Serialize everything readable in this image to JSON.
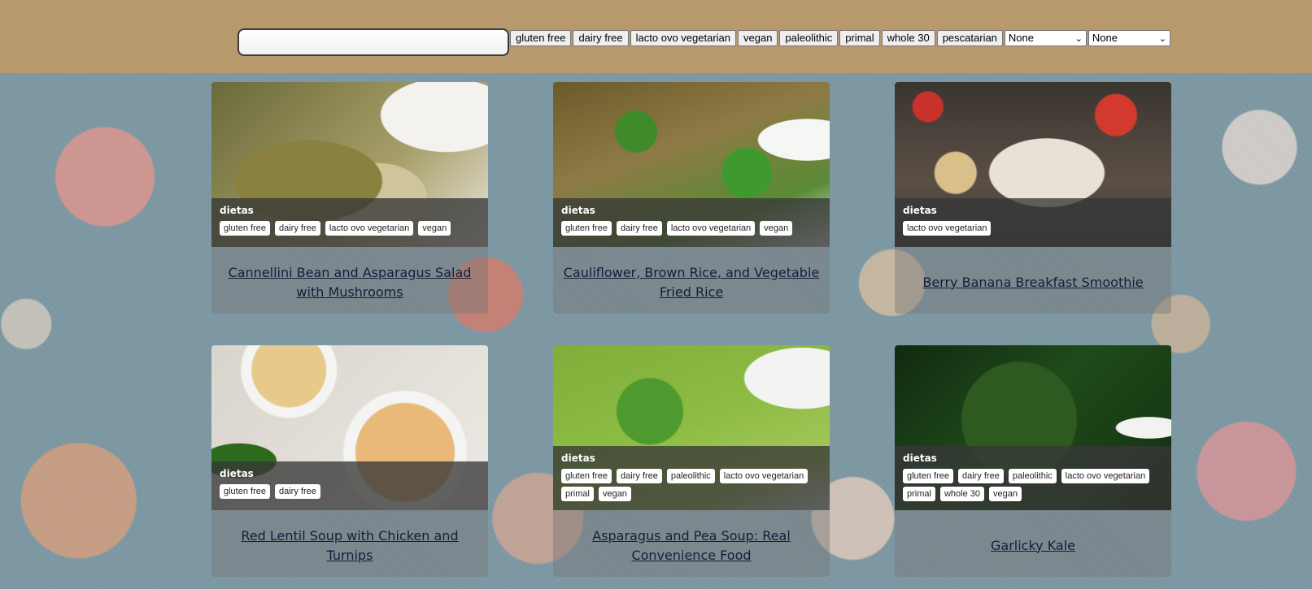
{
  "search": {
    "value": "",
    "placeholder": ""
  },
  "filters": [
    "gluten free",
    "dairy free",
    "lacto ovo vegetarian",
    "vegan",
    "paleolithic",
    "primal",
    "whole 30",
    "pescatarian"
  ],
  "selects": [
    {
      "value": "None"
    },
    {
      "value": "None"
    }
  ],
  "cards": [
    {
      "diet_label": "dietas",
      "tags": [
        "gluten free",
        "dairy free",
        "lacto ovo vegetarian",
        "vegan"
      ],
      "title": "Cannellini Bean and Asparagus Salad with Mushrooms"
    },
    {
      "diet_label": "dietas",
      "tags": [
        "gluten free",
        "dairy free",
        "lacto ovo vegetarian",
        "vegan"
      ],
      "title": "Cauliflower, Brown Rice, and Vegetable Fried Rice"
    },
    {
      "diet_label": "dietas",
      "tags": [
        "lacto ovo vegetarian"
      ],
      "title": "Berry Banana Breakfast Smoothie"
    },
    {
      "diet_label": "dietas",
      "tags": [
        "gluten free",
        "dairy free"
      ],
      "title": "Red Lentil Soup with Chicken and Turnips"
    },
    {
      "diet_label": "dietas",
      "tags": [
        "gluten free",
        "dairy free",
        "paleolithic",
        "lacto ovo vegetarian",
        "primal",
        "vegan"
      ],
      "title": "Asparagus and Pea Soup: Real Convenience Food"
    },
    {
      "diet_label": "dietas",
      "tags": [
        "gluten free",
        "dairy free",
        "paleolithic",
        "lacto ovo vegetarian",
        "primal",
        "whole 30",
        "vegan"
      ],
      "title": "Garlicky Kale"
    }
  ],
  "colors": {
    "header_bg": "#b8996e",
    "overlay_bg": "#373737",
    "link": "#1a1a3a"
  }
}
